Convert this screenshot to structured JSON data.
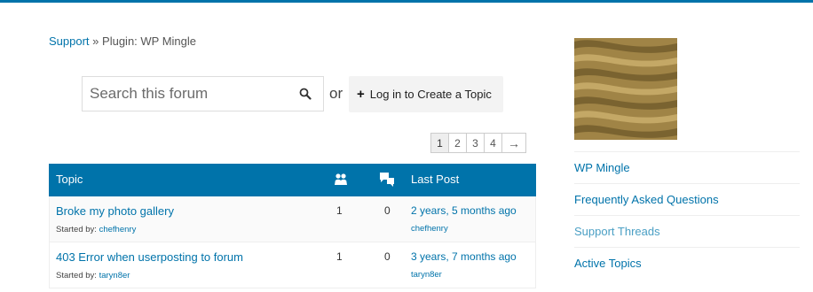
{
  "breadcrumb": {
    "support": "Support",
    "separator": "»",
    "current": "Plugin: WP Mingle"
  },
  "search": {
    "placeholder": "Search this forum",
    "icon": "search-icon"
  },
  "or_text": "or",
  "login": {
    "label": "Log in to Create a Topic",
    "icon": "plus-icon"
  },
  "pagination": {
    "pages": [
      "1",
      "2",
      "3",
      "4"
    ],
    "next": "→",
    "current": "1"
  },
  "table": {
    "headers": {
      "topic": "Topic",
      "voices_icon": "voices-icon",
      "replies_icon": "replies-icon",
      "last_post": "Last Post"
    },
    "rows": [
      {
        "title": "Broke my photo gallery",
        "started_by": "Started by:",
        "author": "chefhenry",
        "voices": "1",
        "replies": "0",
        "freshness": "2 years, 5 months ago",
        "last_author": "chefhenry"
      },
      {
        "title": "403 Error when userposting to forum",
        "started_by": "Started by:",
        "author": "taryn8er",
        "voices": "1",
        "replies": "0",
        "freshness": "3 years, 7 months ago",
        "last_author": "taryn8er"
      }
    ]
  },
  "sidebar": {
    "nav": [
      {
        "label": "WP Mingle"
      },
      {
        "label": "Frequently Asked Questions"
      },
      {
        "label": "Support Threads"
      },
      {
        "label": "Active Topics"
      }
    ]
  },
  "colors": {
    "accent": "#0073aa",
    "banner_gold": "#a08446"
  }
}
